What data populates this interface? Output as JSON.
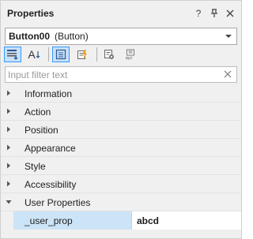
{
  "panel": {
    "title": "Properties",
    "title_icons": [
      "help-icon",
      "pin-icon",
      "close-icon"
    ],
    "help_label": "?"
  },
  "object_selector": {
    "name": "Button00",
    "type": "(Button)"
  },
  "toolbar": {
    "buttons": [
      {
        "icon": "categorized-icon",
        "active": true
      },
      {
        "icon": "alphabetical-sort-icon",
        "label": "A",
        "active": false
      },
      {
        "icon": "properties-icon",
        "active": true
      },
      {
        "icon": "events-icon",
        "active": false
      },
      {
        "icon": "object-settings-icon",
        "active": false
      },
      {
        "icon": "init-icon",
        "active": false
      }
    ]
  },
  "filter": {
    "placeholder": "Input filter text",
    "value": ""
  },
  "categories": [
    {
      "label": "Information",
      "expanded": false
    },
    {
      "label": "Action",
      "expanded": false
    },
    {
      "label": "Position",
      "expanded": false
    },
    {
      "label": "Appearance",
      "expanded": false
    },
    {
      "label": "Style",
      "expanded": false
    },
    {
      "label": "Accessibility",
      "expanded": false
    },
    {
      "label": "User Properties",
      "expanded": true
    }
  ],
  "user_properties": [
    {
      "name": "_user_prop",
      "value": "abcd"
    }
  ],
  "colors": {
    "panel_bg": "#f0f0f0",
    "selection_bg": "#cce4f7",
    "active_button_bg": "#c9e0f7",
    "active_button_border": "#3399ff"
  }
}
